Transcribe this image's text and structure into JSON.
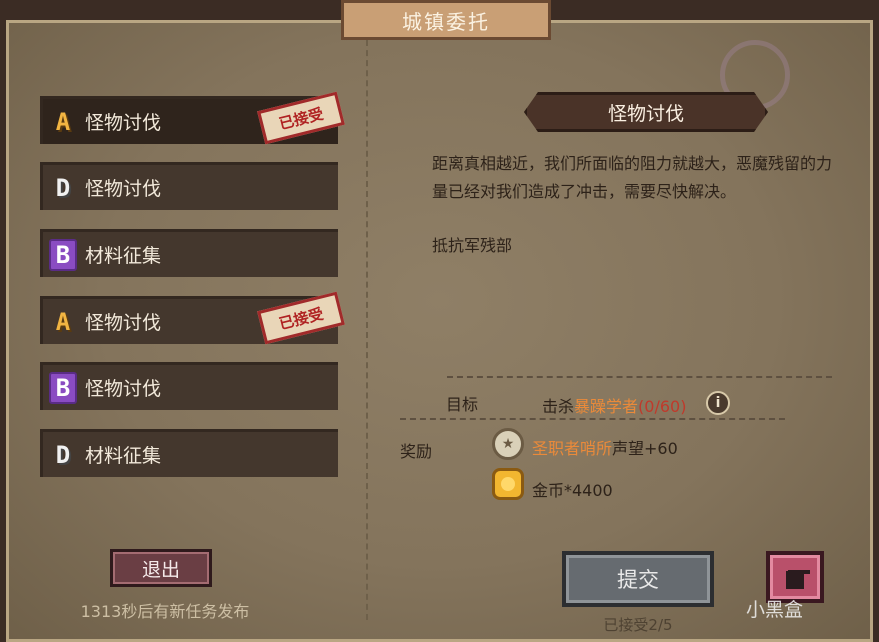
{
  "title": "城镇委托",
  "quests": [
    {
      "grade": "A",
      "label": "怪物讨伐",
      "accepted": true,
      "selected": true
    },
    {
      "grade": "D",
      "label": "怪物讨伐",
      "accepted": false,
      "selected": false
    },
    {
      "grade": "B",
      "label": "材料征集",
      "accepted": false,
      "selected": false
    },
    {
      "grade": "A",
      "label": "怪物讨伐",
      "accepted": true,
      "selected": false
    },
    {
      "grade": "B",
      "label": "怪物讨伐",
      "accepted": false,
      "selected": false
    },
    {
      "grade": "D",
      "label": "材料征集",
      "accepted": false,
      "selected": false
    }
  ],
  "accepted_stamp": "已接受",
  "exit_label": "退出",
  "countdown": "1313秒后有新任务发布",
  "detail": {
    "title": "怪物讨伐",
    "description": "距离真相越近，我们所面临的阻力就越大，恶魔残留的力量已经对我们造成了冲击，需要尽快解决。",
    "faction": "抵抗军残部",
    "objective_label": "目标",
    "objective_prefix": "击杀",
    "objective_target": "暴躁学者",
    "objective_progress": "(0/60)",
    "reward_label": "奖励",
    "reward1_place": "圣职者哨所",
    "reward1_suffix": "声望+60",
    "reward2": "金币*4400"
  },
  "submit_label": "提交",
  "accepted_count": "已接受2/5",
  "watermark": "小黑盒",
  "icons": {
    "info": "info-icon",
    "reputation": "reputation-badge-icon",
    "coin": "gold-coin-icon",
    "trash": "trash-icon"
  },
  "colors": {
    "highlight": "#ea8a3a",
    "progress": "#c0392b",
    "stamp": "#b02323",
    "grade_A": "#f2b542",
    "grade_B": "#8a4cc2",
    "grade_D": "#f1f1f1"
  }
}
